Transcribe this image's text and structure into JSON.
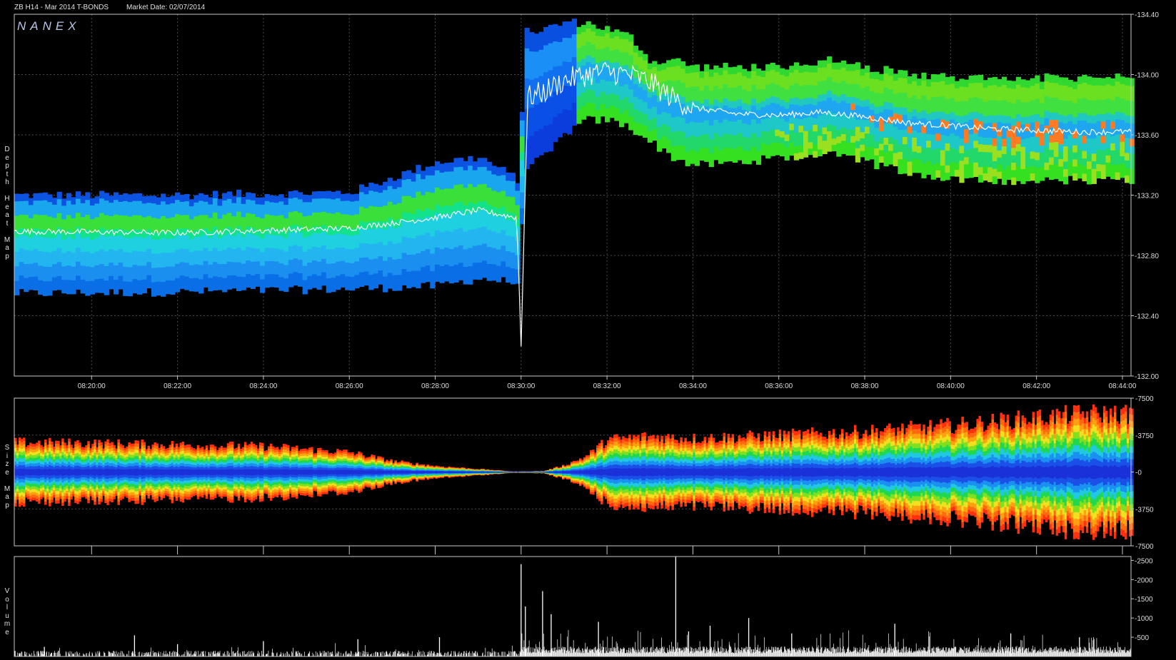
{
  "header": {
    "instrument": "ZB H14 - Mar 2014 T-BONDS",
    "market_date": "Market Date: 02/07/2014"
  },
  "logo": "NANEX",
  "panels": {
    "depth": {
      "label": "Depth Heat Map"
    },
    "size": {
      "label": "Size Map"
    },
    "volume": {
      "label": "Volume"
    }
  },
  "colors": {
    "background": "#000000",
    "panel_border": "#c8c8c8",
    "grid": "#4a4a4a",
    "price_line": "#ffffff",
    "volume_bars": "#ffffff"
  },
  "chart_data": [
    {
      "type": "heatmap",
      "title": "Depth Heat Map",
      "x_ticks": [
        "08:20:00",
        "08:22:00",
        "08:24:00",
        "08:26:00",
        "08:28:00",
        "08:30:00",
        "08:32:00",
        "08:34:00",
        "08:36:00",
        "08:38:00",
        "08:40:00",
        "08:42:00",
        "08:44:00"
      ],
      "y_ticks": [
        "-132.00",
        "-132.40",
        "-132.80",
        "-133.20",
        "-133.60",
        "-134.00",
        "-134.40"
      ],
      "ylim": [
        132.0,
        134.4
      ],
      "xlim_minutes": [
        18.2,
        44.2
      ],
      "grid": true,
      "price_trace": {
        "minutes": [
          18.2,
          22.0,
          26.0,
          28.0,
          29.0,
          29.9,
          30.0,
          30.15,
          30.5,
          31.0,
          31.5,
          32.0,
          32.5,
          33.0,
          33.5,
          34.0,
          35.0,
          36.0,
          37.0,
          38.0,
          39.0,
          40.0,
          41.0,
          42.0,
          43.0,
          44.2
        ],
        "price": [
          132.96,
          132.95,
          132.98,
          133.05,
          133.1,
          133.05,
          132.2,
          133.85,
          133.88,
          133.96,
          134.0,
          134.02,
          134.0,
          133.95,
          133.85,
          133.78,
          133.74,
          133.73,
          133.75,
          133.72,
          133.68,
          133.66,
          133.64,
          133.63,
          133.62,
          133.62
        ]
      },
      "book_band": {
        "minutes": [
          18.2,
          22.0,
          26.0,
          28.0,
          29.0,
          29.9,
          30.05,
          30.5,
          31.0,
          31.5,
          32.0,
          32.5,
          33.0,
          33.5,
          34.0,
          35.0,
          36.0,
          37.0,
          38.0,
          39.0,
          40.0,
          41.0,
          42.0,
          43.0,
          44.2
        ],
        "high": [
          133.2,
          133.2,
          133.22,
          133.42,
          133.45,
          133.3,
          134.28,
          134.3,
          134.35,
          134.34,
          134.3,
          134.25,
          134.08,
          134.1,
          134.05,
          134.05,
          134.05,
          134.1,
          134.05,
          134.0,
          133.98,
          133.98,
          133.98,
          133.98,
          133.98
        ],
        "low": [
          132.55,
          132.56,
          132.58,
          132.6,
          132.65,
          132.62,
          133.4,
          133.45,
          133.62,
          133.7,
          133.7,
          133.65,
          133.55,
          133.45,
          133.4,
          133.42,
          133.45,
          133.48,
          133.42,
          133.35,
          133.3,
          133.3,
          133.3,
          133.3,
          133.3
        ]
      }
    },
    {
      "type": "area",
      "title": "Size Map",
      "y_ticks": [
        "-7500",
        "-3750",
        "-0",
        "-3750",
        "-7500"
      ],
      "ylim": [
        -7500,
        7500
      ],
      "xlim_minutes": [
        18.2,
        44.2
      ],
      "grid": true,
      "envelope": {
        "minutes": [
          18.2,
          20.0,
          22.0,
          24.0,
          26.0,
          27.0,
          28.0,
          29.0,
          29.8,
          30.5,
          31.0,
          31.5,
          32.0,
          33.0,
          34.0,
          36.0,
          38.0,
          40.0,
          42.0,
          43.0,
          44.2
        ],
        "size": [
          3000,
          2900,
          2750,
          2600,
          2000,
          1100,
          600,
          300,
          50,
          100,
          700,
          1600,
          3300,
          3600,
          3400,
          3700,
          4100,
          4700,
          5500,
          5900,
          5900
        ]
      }
    },
    {
      "type": "bar",
      "title": "Volume",
      "y_ticks": [
        "-500",
        "-1000",
        "-1500",
        "-2000",
        "-2500"
      ],
      "ylim": [
        0,
        2600
      ],
      "xlim_minutes": [
        18.2,
        44.2
      ],
      "grid": false,
      "spikes": {
        "minutes": [
          18.9,
          21.0,
          22.0,
          24.0,
          26.2,
          28.1,
          30.0,
          30.1,
          30.5,
          30.7,
          31.8,
          33.6,
          33.9,
          34.4,
          35.3,
          36.3,
          38.7,
          41.4,
          43.0
        ],
        "volume": [
          250,
          550,
          320,
          400,
          450,
          500,
          2400,
          1300,
          1700,
          1100,
          900,
          2600,
          650,
          800,
          1000,
          600,
          850,
          600,
          500
        ]
      }
    }
  ]
}
